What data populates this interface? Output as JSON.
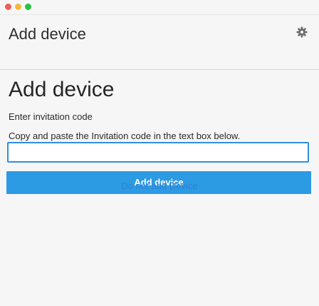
{
  "window": {
    "controls": [
      "close",
      "minimize",
      "maximize"
    ],
    "control_colors": {
      "close": "#f25c54",
      "minimize": "#f5b83b",
      "maximize": "#29c23f"
    }
  },
  "header": {
    "title": "Add device",
    "settings_icon": "gear-icon"
  },
  "main": {
    "title": "Add device",
    "subtitle": "Enter invitation code",
    "instructions": "Copy and paste the Invitation code in the text box below.",
    "code_input": {
      "value": "",
      "placeholder": ""
    },
    "primary_button_label": "Add device",
    "secondary_link_label": "Do not add Device"
  },
  "colors": {
    "accent": "#2d9ae4",
    "link": "#2a84d2",
    "input_border": "#2f8fe0"
  }
}
